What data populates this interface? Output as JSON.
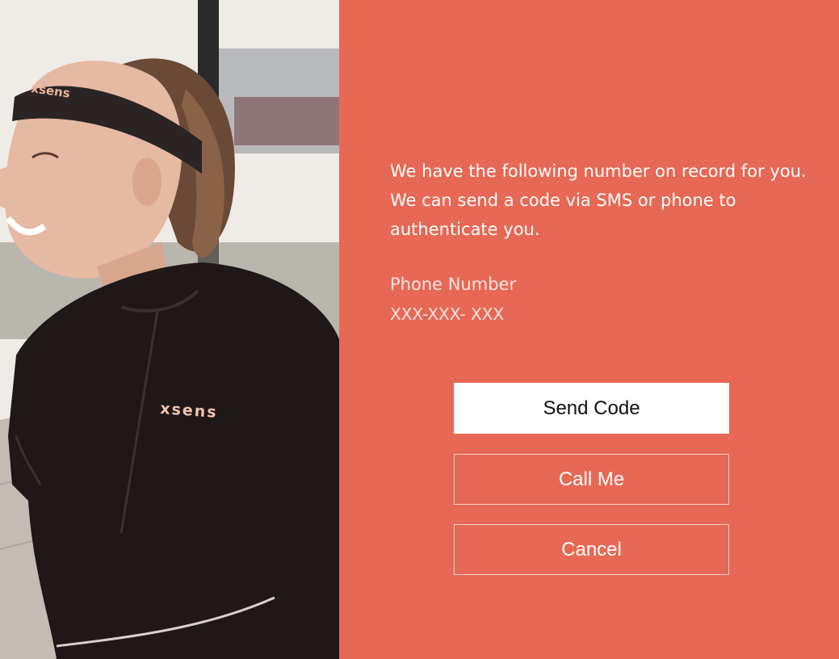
{
  "hero": {
    "alt": "Smiling woman in xsens headband and shirt",
    "headband_brand": "xsens",
    "shirt_brand": "xsens"
  },
  "auth": {
    "message": "We have the following number on record for you. We can send a code via SMS or phone to authenticate you.",
    "phone_label": "Phone Number",
    "phone_value": "XXX-XXX- XXX"
  },
  "buttons": {
    "send_code": "Send Code",
    "call_me": "Call Me",
    "cancel": "Cancel"
  },
  "colors": {
    "panel": "#e76855",
    "primary_button_bg": "#ffffff",
    "text": "#ffffff"
  }
}
